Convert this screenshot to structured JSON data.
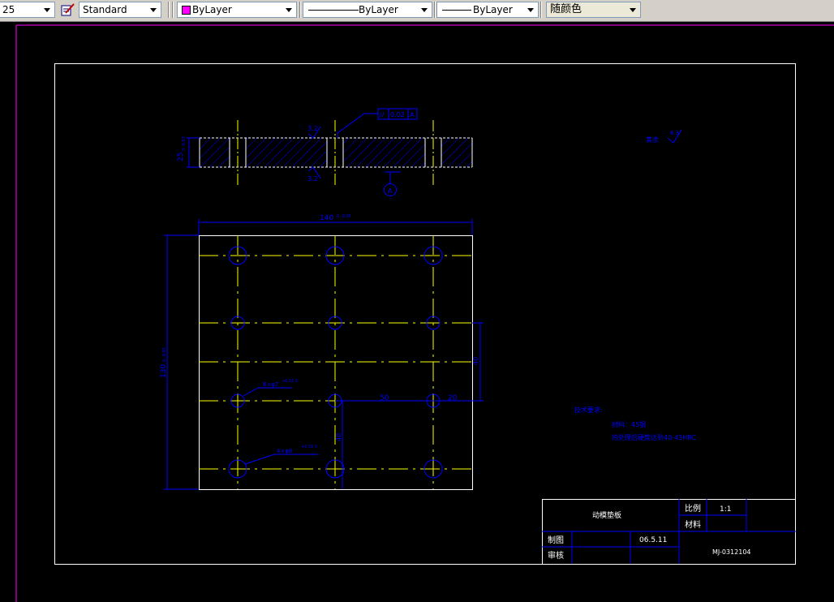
{
  "toolbar": {
    "textscale_value": "25",
    "textstyle_value": "Standard",
    "layer_color_value": "ByLayer",
    "linetype_value": "ByLayer",
    "lineweight_value": "ByLayer",
    "plotstyle_value": "随颜色"
  },
  "drawing": {
    "section_view": {
      "dim_thickness": "25",
      "dim_thickness_tol": "0 -0.03",
      "roughness_top": "3.2",
      "roughness_bottom": "3.2",
      "gdt_symbol": "//",
      "gdt_tolerance": "0.02",
      "gdt_datum": "A",
      "datum_label": "A"
    },
    "plan_view": {
      "dim_width": "140",
      "dim_width_tol": "0 -0.05",
      "dim_height": "130",
      "dim_height_tol": "0 -0.05",
      "hole_callout_upper": "6×φ7",
      "hole_callout_upper_tol": "+0.02 0",
      "hole_callout_lower": "4×φ8",
      "hole_callout_lower_tol": "+0.02 0",
      "dim_50": "50",
      "dim_20": "20",
      "dim_vertical_right": "40",
      "dim_vertical_bottom": "40"
    },
    "notes": {
      "roughness_remaining_label": "其余",
      "roughness_remaining_value": "6.3",
      "tech_title": "技术要求:",
      "tech_line1": "材料：45钢",
      "tech_line2": "热处理后硬度达到40-43HRC"
    },
    "title_block": {
      "part_name": "动模垫板",
      "scale_label": "比例",
      "scale_value": "1:1",
      "material_label": "材料",
      "drawn_label": "制图",
      "date_value": "06.5.11",
      "review_label": "审核",
      "drawing_no": "MJ-0312104"
    }
  },
  "colors": {
    "background": "#000000",
    "frame": "#ffffff",
    "geometry": "#ffffff",
    "centerline": "#ffff00",
    "dimension": "#0000ff",
    "magenta": "#ff00ff"
  }
}
